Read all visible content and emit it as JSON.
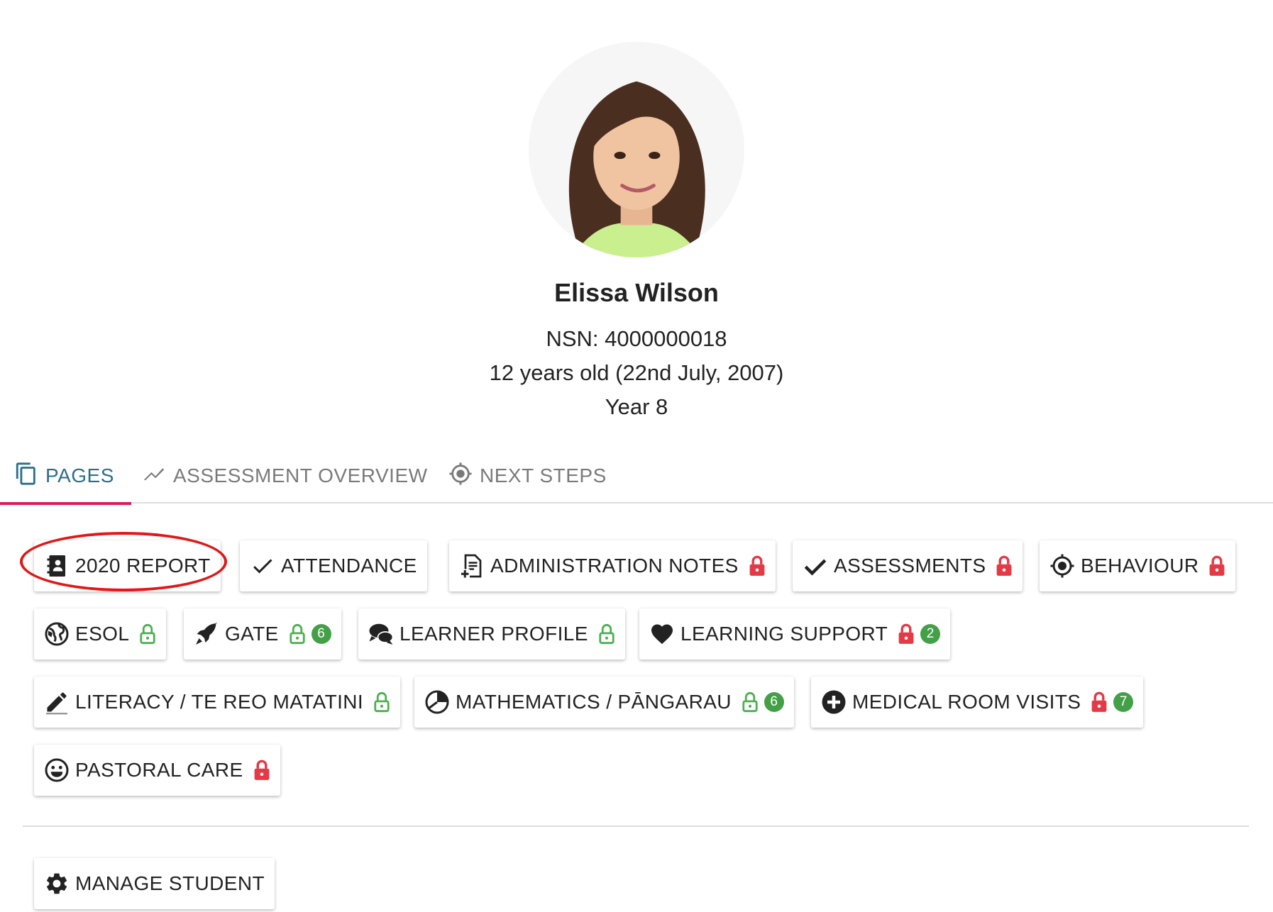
{
  "student": {
    "name": "Elissa Wilson",
    "nsn": "NSN: 4000000018",
    "age": "12 years old (22nd July, 2007)",
    "year": "Year 8"
  },
  "tabs": [
    {
      "label": "PAGES",
      "icon": "copy-pages-icon",
      "active": true
    },
    {
      "label": "ASSESSMENT OVERVIEW",
      "icon": "trending-line-icon",
      "active": false
    },
    {
      "label": "NEXT STEPS",
      "icon": "crosshair-icon",
      "active": false
    }
  ],
  "pages": [
    {
      "label": "2020 REPORT",
      "icon": "contact-book-icon",
      "lock": null,
      "highlighted": true
    },
    {
      "label": "ATTENDANCE",
      "icon": "check-icon",
      "lock": null
    },
    {
      "label": "ADMINISTRATION NOTES",
      "icon": "note-add-icon",
      "lock": "locked"
    },
    {
      "label": "ASSESSMENTS",
      "icon": "check-bold-icon",
      "lock": "locked"
    },
    {
      "label": "BEHAVIOUR",
      "icon": "crosshair-icon",
      "lock": "locked"
    },
    {
      "label": "ESOL",
      "icon": "globe-icon",
      "lock": "unlocked"
    },
    {
      "label": "GATE",
      "icon": "rocket-icon",
      "lock": "unlocked",
      "badge": "6"
    },
    {
      "label": "LEARNER PROFILE",
      "icon": "chat-bubbles-icon",
      "lock": "unlocked"
    },
    {
      "label": "LEARNING SUPPORT",
      "icon": "heart-icon",
      "lock": "locked",
      "badge": "2"
    },
    {
      "label": "LITERACY / TE REO MATATINI",
      "icon": "pen-icon",
      "lock": "unlocked"
    },
    {
      "label": "MATHEMATICS / PĀNGARAU",
      "icon": "pie-chart-icon",
      "lock": "unlocked",
      "badge": "6"
    },
    {
      "label": "MEDICAL ROOM VISITS",
      "icon": "plus-circle-icon",
      "lock": "locked",
      "badge": "7"
    },
    {
      "label": "PASTORAL CARE",
      "icon": "smiley-icon",
      "lock": "locked"
    }
  ],
  "manage": {
    "label": "MANAGE STUDENT",
    "icon": "gear-icon"
  },
  "colors": {
    "active_tab": "#2a6f8c",
    "tab_indicator": "#d81b60",
    "locked": "#e53945",
    "unlocked": "#4caf50",
    "badge": "#43a047",
    "highlight": "#e01818",
    "avatar_ring": "#7cc56f"
  }
}
